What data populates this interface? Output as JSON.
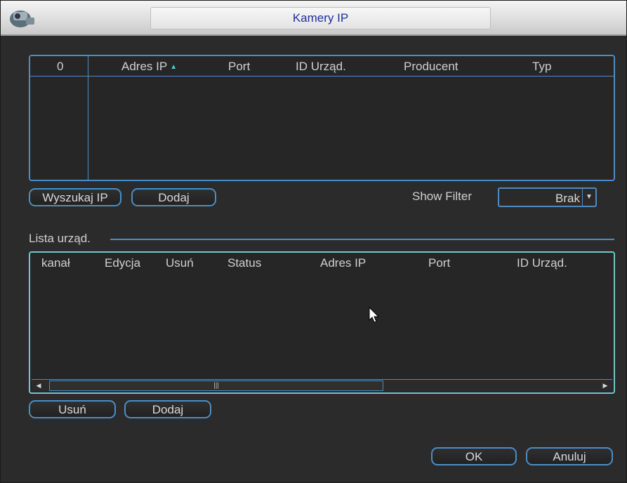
{
  "window": {
    "title": "Kamery IP"
  },
  "search_table": {
    "columns": [
      "0",
      "Adres IP",
      "Port",
      "ID Urząd.",
      "Producent",
      "Typ"
    ]
  },
  "buttons": {
    "search": "Wyszukaj IP",
    "add_top": "Dodaj",
    "delete": "Usuń",
    "add_bottom": "Dodaj",
    "ok": "OK",
    "cancel": "Anuluj"
  },
  "filter": {
    "label": "Show Filter",
    "value": "Brak"
  },
  "device_list": {
    "title": "Lista urząd.",
    "columns": [
      "kanał",
      "Edycja",
      "Usuń",
      "Status",
      "Adres IP",
      "Port",
      "ID Urząd."
    ]
  },
  "colors": {
    "accent": "#4b8dc6",
    "title_text": "#1c2fa0",
    "background": "#2b2b2b"
  }
}
